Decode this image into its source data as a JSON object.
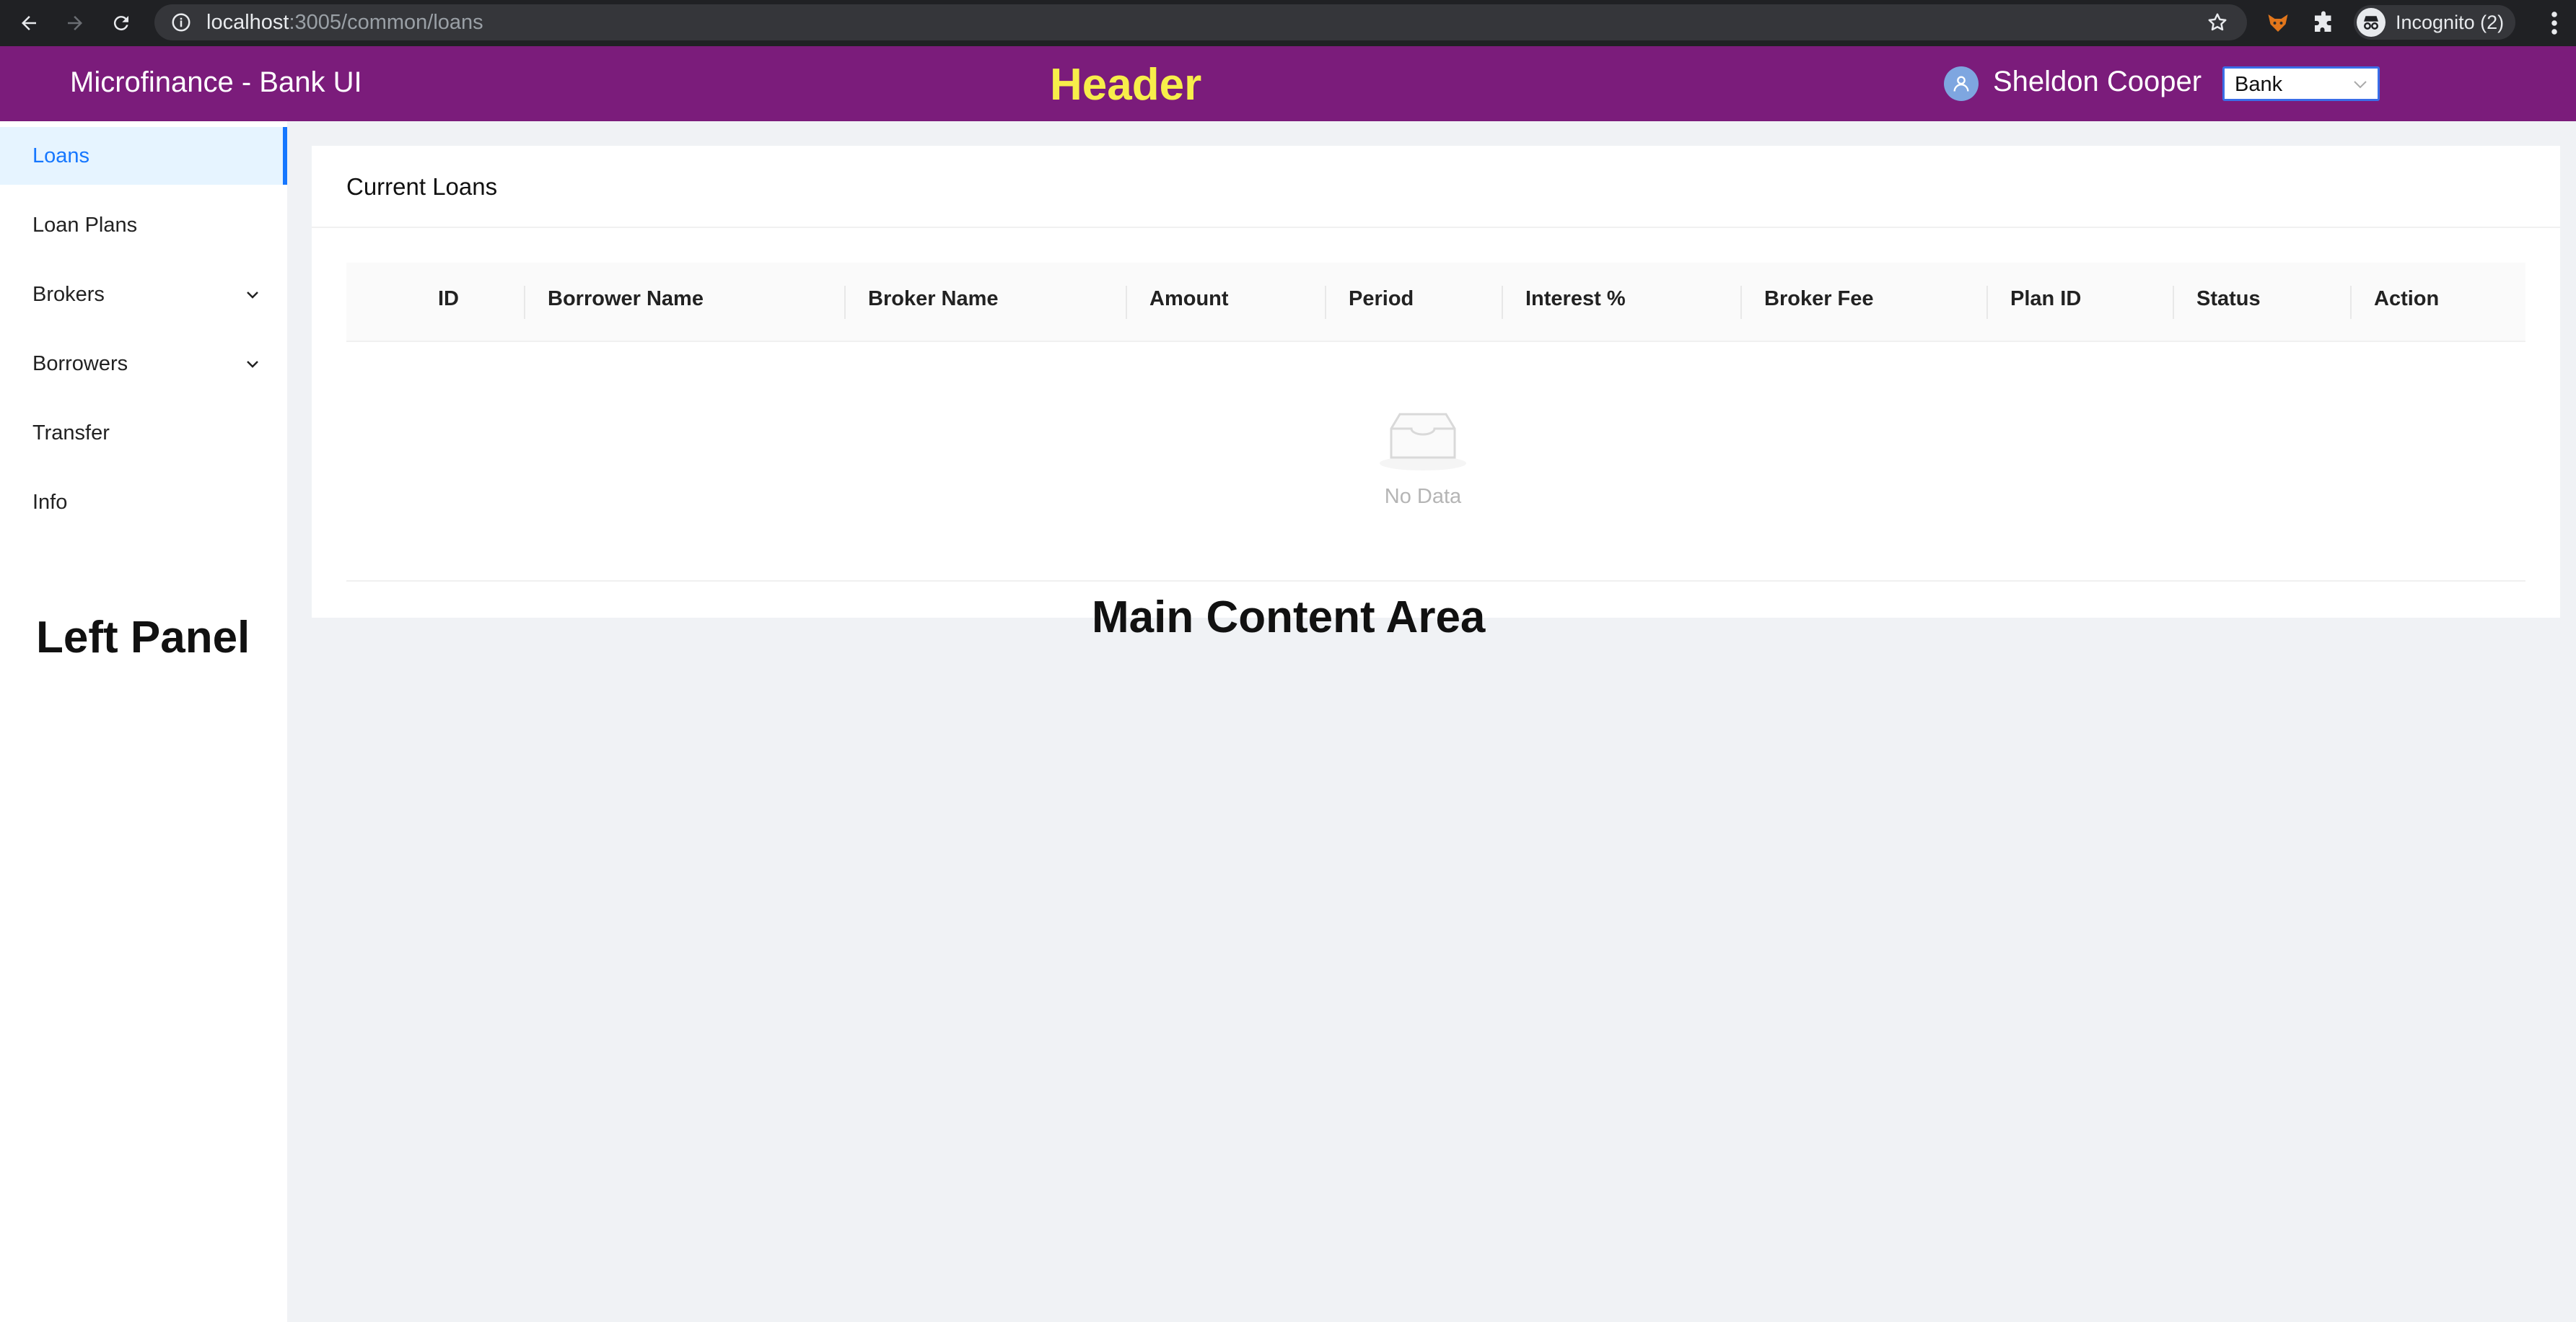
{
  "browser": {
    "url_host": "localhost",
    "url_path": ":3005/common/loans",
    "incognito_label": "Incognito (2)"
  },
  "header": {
    "app_title": "Microfinance - Bank UI",
    "overlay_label": "Header",
    "user_name": "Sheldon Cooper",
    "role_selected": "Bank",
    "brand_color": "#7b1c7b",
    "overlay_color": "#f7ee4a"
  },
  "sidebar": {
    "items": [
      {
        "label": "Loans",
        "active": true
      },
      {
        "label": "Loan Plans"
      },
      {
        "label": "Brokers",
        "expandable": true
      },
      {
        "label": "Borrowers",
        "expandable": true
      },
      {
        "label": "Transfer"
      },
      {
        "label": "Info"
      }
    ],
    "overlay_label": "Left Panel",
    "accent_color": "#1677ff"
  },
  "main": {
    "card_title": "Current Loans",
    "columns": [
      "ID",
      "Borrower Name",
      "Broker Name",
      "Amount",
      "Period",
      "Interest %",
      "Broker Fee",
      "Plan ID",
      "Status",
      "Action"
    ],
    "empty_text": "No Data",
    "overlay_label": "Main Content Area"
  }
}
